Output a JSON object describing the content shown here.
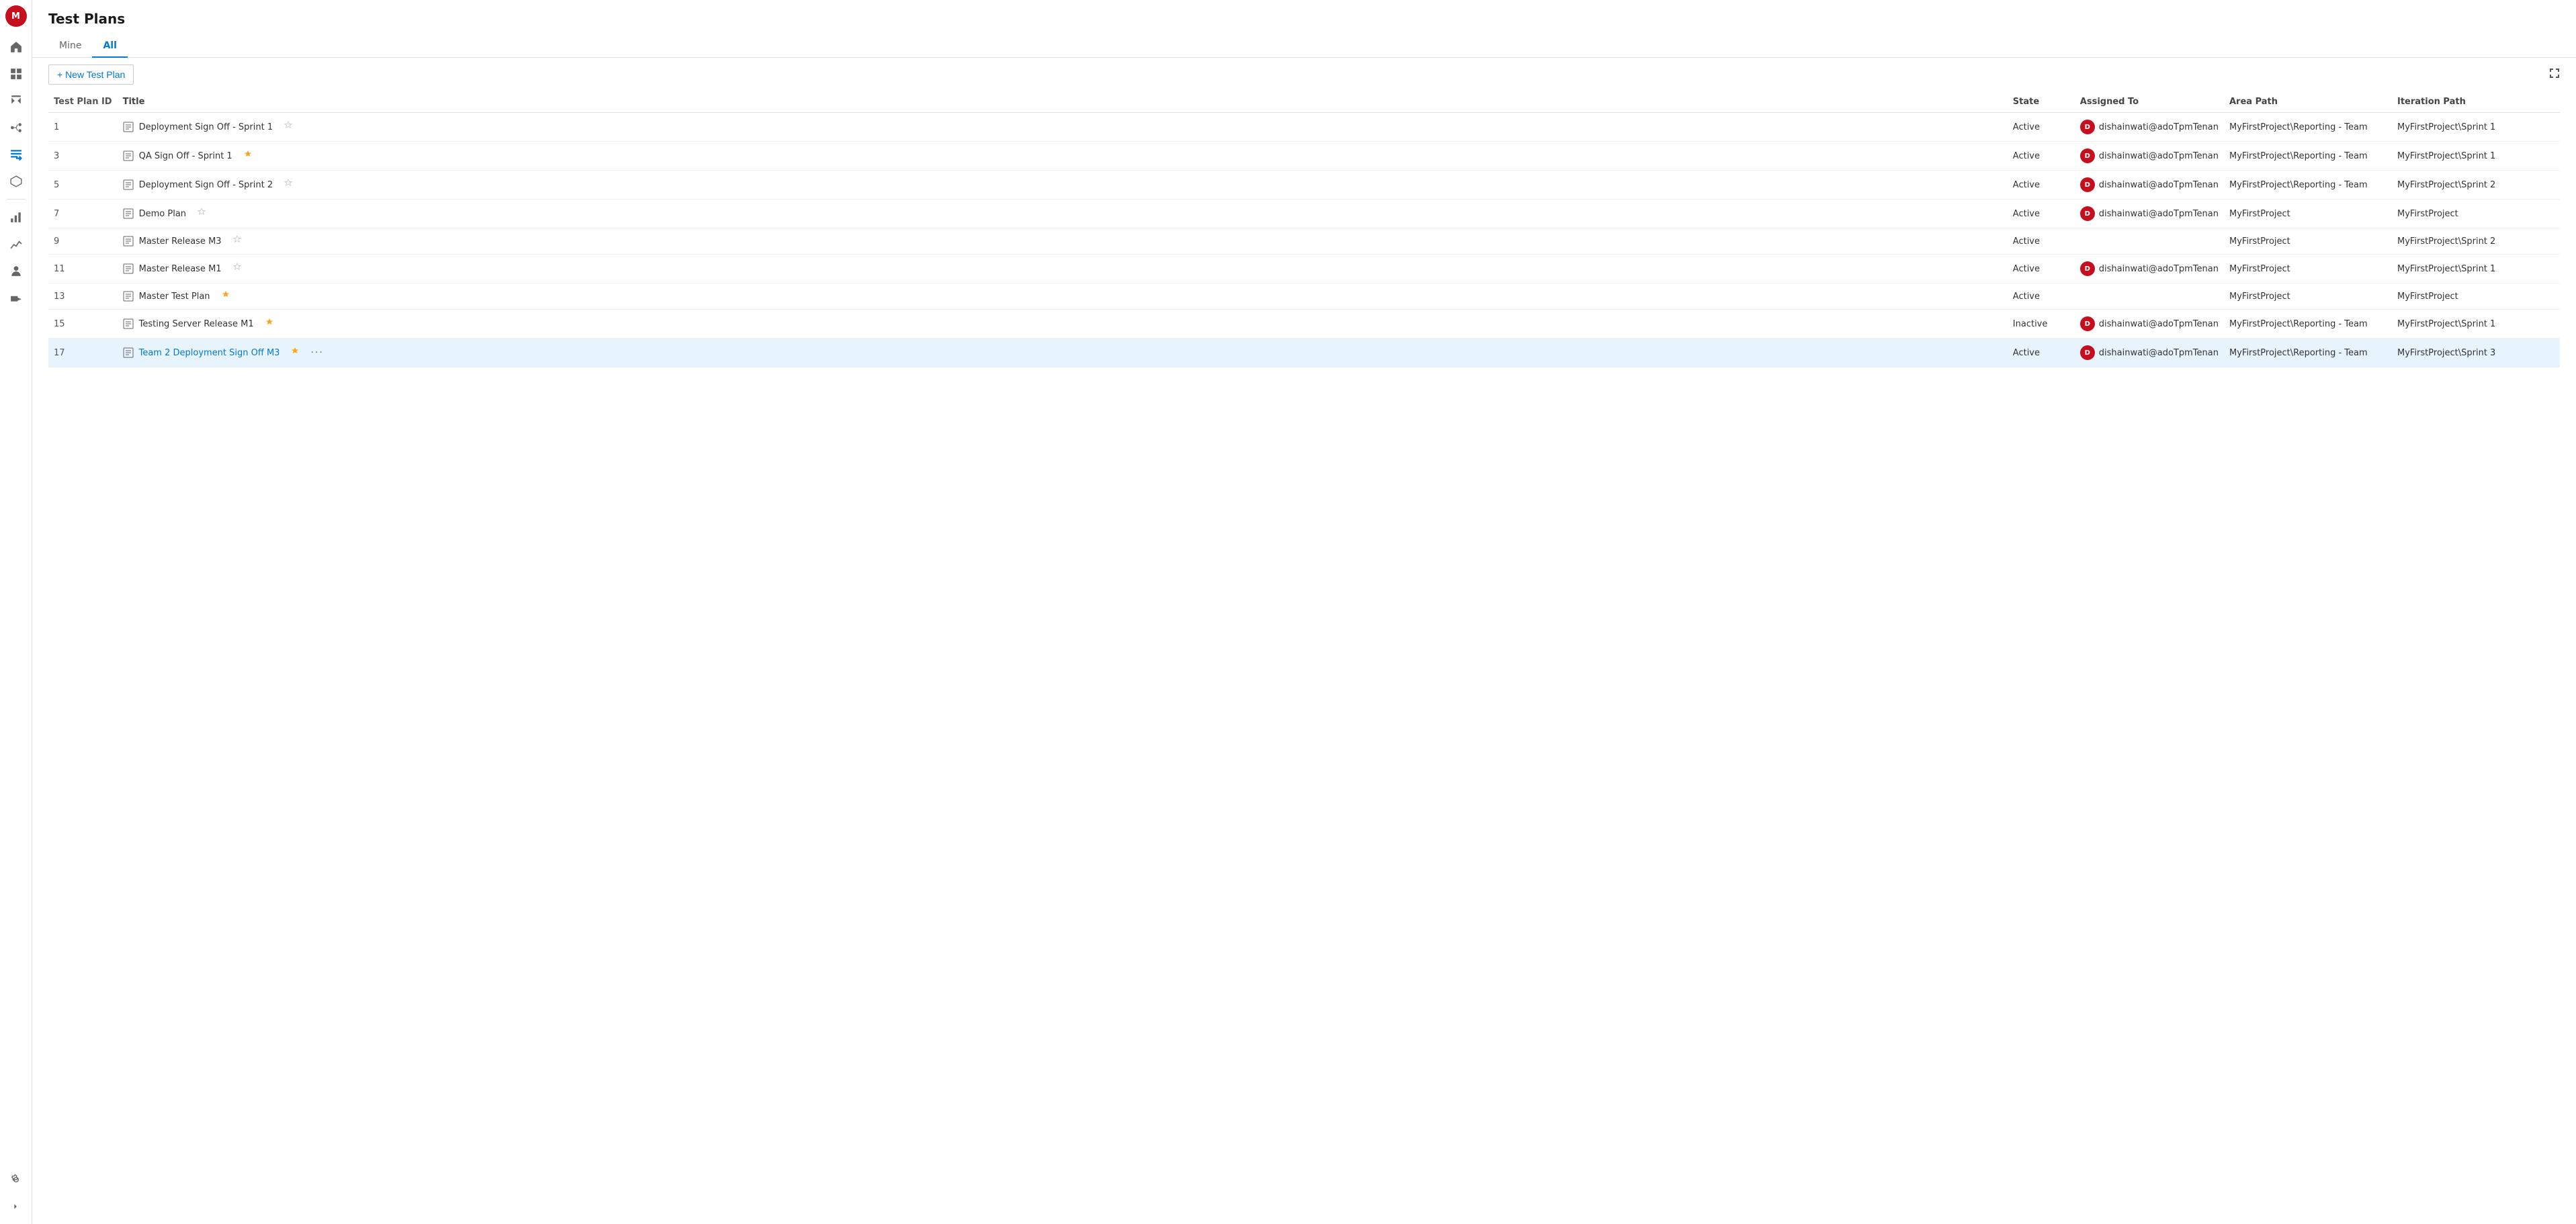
{
  "app": {
    "avatar": "M",
    "page_title": "Test Plans"
  },
  "sidebar": {
    "icons": [
      {
        "name": "home-icon",
        "symbol": "⌂",
        "active": false
      },
      {
        "name": "boards-icon",
        "symbol": "▦",
        "active": false
      },
      {
        "name": "repos-icon",
        "symbol": "⎇",
        "active": false
      },
      {
        "name": "pipelines-icon",
        "symbol": "▷",
        "active": false
      },
      {
        "name": "test-plans-icon",
        "symbol": "✓",
        "active": true
      },
      {
        "name": "artifacts-icon",
        "symbol": "📦",
        "active": false
      },
      {
        "name": "reports-icon",
        "symbol": "📊",
        "active": false
      },
      {
        "name": "analytics-icon",
        "symbol": "📈",
        "active": false
      },
      {
        "name": "stakeholder-icon",
        "symbol": "👤",
        "active": false
      },
      {
        "name": "delivery-icon",
        "symbol": "🚀",
        "active": false
      }
    ],
    "settings_label": "⚙",
    "expand_label": "«"
  },
  "tabs": [
    {
      "id": "mine",
      "label": "Mine",
      "active": false
    },
    {
      "id": "all",
      "label": "All",
      "active": true
    }
  ],
  "toolbar": {
    "new_button_label": "+ New Test Plan",
    "filter_icon": "≡",
    "expand_icon": "⤢"
  },
  "table": {
    "columns": [
      {
        "key": "id",
        "label": "Test Plan ID"
      },
      {
        "key": "title",
        "label": "Title"
      },
      {
        "key": "state",
        "label": "State"
      },
      {
        "key": "assigned_to",
        "label": "Assigned To"
      },
      {
        "key": "area_path",
        "label": "Area Path"
      },
      {
        "key": "iteration_path",
        "label": "Iteration Path"
      }
    ],
    "rows": [
      {
        "id": 1,
        "title": "Deployment Sign Off - Sprint 1",
        "title_is_link": false,
        "starred": false,
        "state": "Active",
        "assigned_to": "dishainwati@adoTpmTenan",
        "area_path": "MyFirstProject\\Reporting - Team",
        "iteration_path": "MyFirstProject\\Sprint 1"
      },
      {
        "id": 3,
        "title": "QA Sign Off - Sprint 1",
        "title_is_link": false,
        "starred": true,
        "state": "Active",
        "assigned_to": "dishainwati@adoTpmTenan",
        "area_path": "MyFirstProject\\Reporting - Team",
        "iteration_path": "MyFirstProject\\Sprint 1"
      },
      {
        "id": 5,
        "title": "Deployment Sign Off - Sprint 2",
        "title_is_link": false,
        "starred": false,
        "state": "Active",
        "assigned_to": "dishainwati@adoTpmTenan",
        "area_path": "MyFirstProject\\Reporting - Team",
        "iteration_path": "MyFirstProject\\Sprint 2"
      },
      {
        "id": 7,
        "title": "Demo Plan",
        "title_is_link": false,
        "starred": false,
        "state": "Active",
        "assigned_to": "dishainwati@adoTpmTenan",
        "area_path": "MyFirstProject",
        "iteration_path": "MyFirstProject"
      },
      {
        "id": 9,
        "title": "Master Release M3",
        "title_is_link": false,
        "starred": false,
        "state": "Active",
        "assigned_to": "",
        "area_path": "MyFirstProject",
        "iteration_path": "MyFirstProject\\Sprint 2"
      },
      {
        "id": 11,
        "title": "Master Release M1",
        "title_is_link": false,
        "starred": false,
        "state": "Active",
        "assigned_to": "dishainwati@adoTpmTenan",
        "area_path": "MyFirstProject",
        "iteration_path": "MyFirstProject\\Sprint 1"
      },
      {
        "id": 13,
        "title": "Master Test Plan",
        "title_is_link": false,
        "starred": true,
        "state": "Active",
        "assigned_to": "",
        "area_path": "MyFirstProject",
        "iteration_path": "MyFirstProject"
      },
      {
        "id": 15,
        "title": "Testing Server Release M1",
        "title_is_link": false,
        "starred": true,
        "state": "Inactive",
        "assigned_to": "dishainwati@adoTpmTenan",
        "area_path": "MyFirstProject\\Reporting - Team",
        "iteration_path": "MyFirstProject\\Sprint 1"
      },
      {
        "id": 17,
        "title": "Team 2 Deployment Sign Off M3",
        "title_is_link": true,
        "starred": true,
        "has_more": true,
        "state": "Active",
        "assigned_to": "dishainwati@adoTpmTenan",
        "area_path": "MyFirstProject\\Reporting - Team",
        "iteration_path": "MyFirstProject\\Sprint 3"
      }
    ]
  }
}
